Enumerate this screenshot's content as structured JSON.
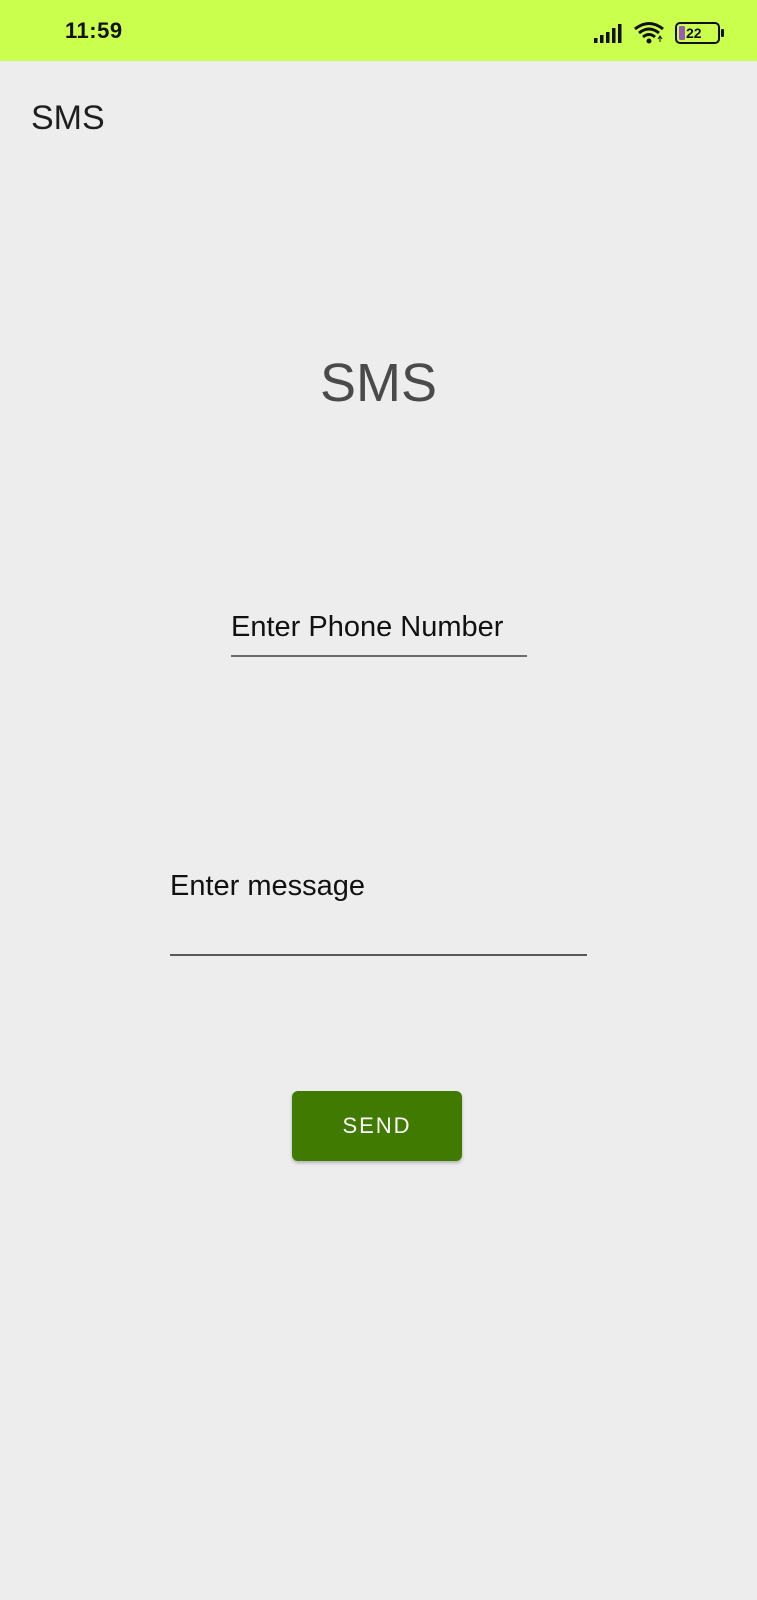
{
  "status_bar": {
    "time": "11:59",
    "battery_level": "22",
    "background_color": "#CBFF4D",
    "icons": [
      "signal-icon",
      "wifi-icon",
      "battery-icon"
    ]
  },
  "app_bar": {
    "title": "SMS"
  },
  "main": {
    "heading": "SMS",
    "phone_field": {
      "placeholder": "Enter Phone Number",
      "value": ""
    },
    "message_field": {
      "placeholder": "Enter message",
      "value": ""
    },
    "send_button": {
      "label": "SEND",
      "color": "#407A00"
    }
  },
  "colors": {
    "background": "#EDEDED",
    "accent": "#407A00"
  }
}
